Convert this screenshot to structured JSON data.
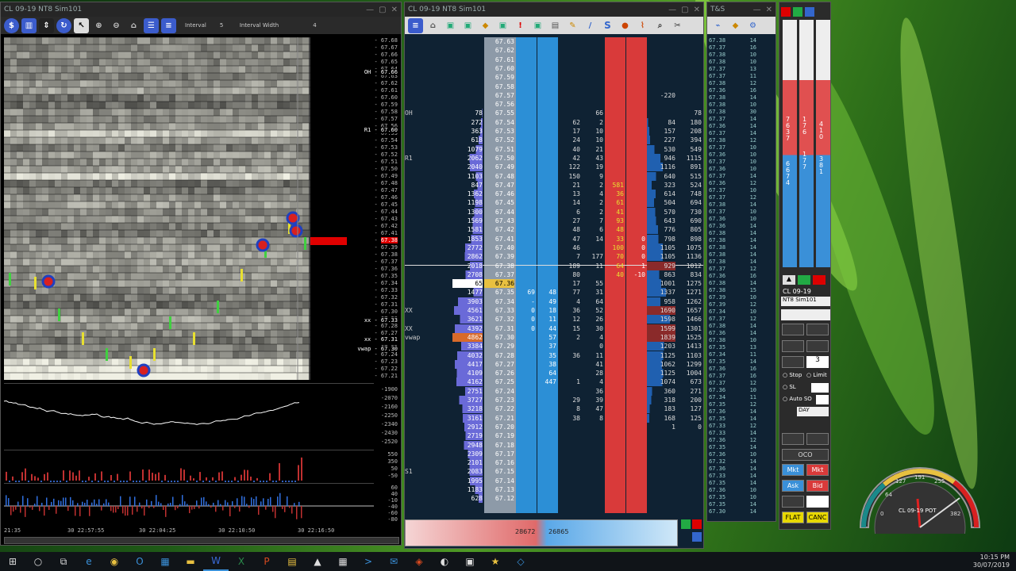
{
  "chart_window": {
    "title": "CL 09-19 NT8 Sim101",
    "toolbar": {
      "interval_label": "Interval",
      "interval_value": "5",
      "width_label": "Interval Width",
      "width_value": "4"
    },
    "price_labels": [
      "67.68",
      "67.67",
      "67.66",
      "67.65",
      "67.64",
      "67.63",
      "67.62",
      "67.61",
      "67.60",
      "67.59",
      "67.58",
      "67.57",
      "67.56",
      "67.55",
      "67.54",
      "67.53",
      "67.52",
      "67.51",
      "67.50",
      "67.49",
      "67.48",
      "67.47",
      "67.46",
      "67.45",
      "67.44",
      "67.43",
      "67.42",
      "67.41",
      "67.40",
      "67.39",
      "67.38",
      "67.37",
      "67.36",
      "67.35",
      "67.34",
      "67.33",
      "67.32",
      "67.31",
      "67.30",
      "67.29",
      "67.28",
      "67.27",
      "67.26",
      "67.25",
      "67.24",
      "67.23",
      "67.22",
      "67.21"
    ],
    "level_tags": {
      "oh": "OH - 67.66",
      "r1": "R1 - 67.60",
      "xx1": "xx - 67.33",
      "xx2": "xx - 67.31",
      "vwap": "vwap - 67.30"
    },
    "current_price": "67.38",
    "delta_scale": [
      "-1900",
      "-2070",
      "-2160",
      "-2250",
      "-2340",
      "-2430",
      "-2520"
    ],
    "vol_scale": [
      "550",
      "350",
      "50",
      "-50"
    ],
    "osc_scale": [
      "60",
      "40",
      "-10",
      "-40",
      "-60",
      "-80"
    ],
    "time_labels": [
      "21:35",
      "30 22:57:55",
      "30 22:04:25",
      "30 22:10:50",
      "30 22:16:50"
    ]
  },
  "dom_window": {
    "title": "CL 09-19 NT8 Sim101",
    "bid_total": "28672",
    "ask_total": "26865",
    "rows": [
      {
        "lbl": "",
        "vol": "",
        "price": "67.63",
        "bid": "",
        "ask": "",
        "c1": "",
        "c2": "",
        "s": "",
        "b": "",
        "d": "",
        "t": ""
      },
      {
        "lbl": "",
        "vol": "",
        "price": "67.62",
        "bid": "",
        "ask": "",
        "c1": "",
        "c2": "",
        "s": "",
        "b": "",
        "d": "",
        "t": ""
      },
      {
        "lbl": "",
        "vol": "",
        "price": "67.61",
        "bid": "",
        "ask": "",
        "c1": "",
        "c2": "",
        "s": "",
        "b": "",
        "d": "",
        "t": ""
      },
      {
        "lbl": "",
        "vol": "",
        "price": "67.60",
        "bid": "",
        "ask": "",
        "c1": "",
        "c2": "",
        "s": "",
        "b": "",
        "d": "",
        "t": ""
      },
      {
        "lbl": "",
        "vol": "",
        "price": "67.59",
        "bid": "",
        "ask": "",
        "c1": "",
        "c2": "",
        "s": "",
        "b": "",
        "d": "",
        "t": ""
      },
      {
        "lbl": "",
        "vol": "",
        "price": "67.58",
        "bid": "",
        "ask": "",
        "c1": "",
        "c2": "",
        "s": "",
        "b": "",
        "d": "",
        "t": ""
      },
      {
        "lbl": "",
        "vol": "",
        "price": "67.57",
        "bid": "",
        "ask": "",
        "c1": "",
        "c2": "",
        "s": "",
        "b": "",
        "d": "-220",
        "t": ""
      },
      {
        "lbl": "",
        "vol": "",
        "price": "67.56",
        "bid": "",
        "ask": "",
        "c1": "",
        "c2": "",
        "s": "",
        "b": "",
        "d": "",
        "t": ""
      },
      {
        "lbl": "OH",
        "vol": "78",
        "price": "67.55",
        "bid": "",
        "ask": "",
        "c1": "",
        "c2": "66",
        "s": "",
        "b": "",
        "d": "",
        "t": "78"
      },
      {
        "lbl": "",
        "vol": "272",
        "price": "67.54",
        "bid": "",
        "ask": "",
        "c1": "62",
        "c2": "2",
        "s": "",
        "b": "",
        "d": "84",
        "t": "180"
      },
      {
        "lbl": "",
        "vol": "363",
        "price": "67.53",
        "bid": "",
        "ask": "",
        "c1": "17",
        "c2": "10",
        "s": "",
        "b": "",
        "d": "157",
        "t": "208"
      },
      {
        "lbl": "",
        "vol": "618",
        "price": "67.52",
        "bid": "",
        "ask": "",
        "c1": "24",
        "c2": "10",
        "s": "",
        "b": "",
        "d": "227",
        "t": "394"
      },
      {
        "lbl": "",
        "vol": "1079",
        "price": "67.51",
        "bid": "",
        "ask": "",
        "c1": "40",
        "c2": "21",
        "s": "",
        "b": "",
        "d": "530",
        "t": "549"
      },
      {
        "lbl": "R1",
        "vol": "2062",
        "price": "67.50",
        "bid": "",
        "ask": "",
        "c1": "42",
        "c2": "43",
        "s": "",
        "b": "",
        "d": "946",
        "t": "1115"
      },
      {
        "lbl": "",
        "vol": "2040",
        "price": "67.49",
        "bid": "",
        "ask": "",
        "c1": "122",
        "c2": "19",
        "s": "",
        "b": "",
        "d": "1116",
        "t": "891"
      },
      {
        "lbl": "",
        "vol": "1103",
        "price": "67.48",
        "bid": "",
        "ask": "",
        "c1": "150",
        "c2": "9",
        "s": "",
        "b": "",
        "d": "640",
        "t": "515"
      },
      {
        "lbl": "",
        "vol": "847",
        "price": "67.47",
        "bid": "",
        "ask": "",
        "c1": "21",
        "c2": "2",
        "s": "581",
        "b": "",
        "d": "323",
        "t": "524"
      },
      {
        "lbl": "",
        "vol": "1362",
        "price": "67.46",
        "bid": "",
        "ask": "",
        "c1": "13",
        "c2": "4",
        "s": "36",
        "b": "",
        "d": "614",
        "t": "748"
      },
      {
        "lbl": "",
        "vol": "1198",
        "price": "67.45",
        "bid": "",
        "ask": "",
        "c1": "14",
        "c2": "2",
        "s": "61",
        "b": "",
        "d": "504",
        "t": "694"
      },
      {
        "lbl": "",
        "vol": "1300",
        "price": "67.44",
        "bid": "",
        "ask": "",
        "c1": "6",
        "c2": "2",
        "s": "41",
        "b": "",
        "d": "570",
        "t": "730"
      },
      {
        "lbl": "",
        "vol": "1569",
        "price": "67.43",
        "bid": "",
        "ask": "",
        "c1": "27",
        "c2": "7",
        "s": "93",
        "b": "",
        "d": "643",
        "t": "690"
      },
      {
        "lbl": "",
        "vol": "1581",
        "price": "67.42",
        "bid": "",
        "ask": "",
        "c1": "48",
        "c2": "6",
        "s": "48",
        "b": "",
        "d": "776",
        "t": "805"
      },
      {
        "lbl": "",
        "vol": "1853",
        "price": "67.41",
        "bid": "",
        "ask": "",
        "c1": "47",
        "c2": "14",
        "s": "33",
        "b": "0",
        "d": "798",
        "t": "898"
      },
      {
        "lbl": "",
        "vol": "2772",
        "price": "67.40",
        "bid": "",
        "ask": "",
        "c1": "46",
        "c2": "",
        "s": "100",
        "b": "0",
        "d": "1105",
        "t": "1075"
      },
      {
        "lbl": "",
        "vol": "2862",
        "price": "67.39",
        "bid": "",
        "ask": "",
        "c1": "7",
        "c2": "177",
        "s": "70",
        "b": "0",
        "d": "1105",
        "t": "1136"
      },
      {
        "lbl": "",
        "vol": "2018",
        "price": "67.38",
        "bid": "",
        "ask": "",
        "c1": "189",
        "c2": "11",
        "s": "64",
        "b": "1",
        "d": "929",
        "t": "1012"
      },
      {
        "lbl": "",
        "vol": "2708",
        "price": "67.37",
        "bid": "",
        "ask": "",
        "c1": "80",
        "c2": "",
        "s": "40",
        "b": "-10",
        "d": "863",
        "t": "834"
      },
      {
        "lbl": "",
        "vol": "65",
        "price": "67.36",
        "bid": "",
        "ask": "",
        "c1": "17",
        "c2": "55",
        "s": "",
        "b": "",
        "d": "1001",
        "t": "1275"
      },
      {
        "lbl": "",
        "vol": "1477",
        "price": "67.35",
        "bid": "69",
        "ask": "48",
        "c1": "77",
        "c2": "31",
        "s": "",
        "b": "",
        "d": "1337",
        "t": "1271"
      },
      {
        "lbl": "",
        "vol": "3903",
        "price": "67.34",
        "bid": "-",
        "ask": "49",
        "c1": "4",
        "c2": "64",
        "s": "",
        "b": "",
        "d": "958",
        "t": "1262"
      },
      {
        "lbl": "XX",
        "vol": "4561",
        "price": "67.33",
        "bid": "0",
        "ask": "18",
        "c1": "36",
        "c2": "52",
        "s": "",
        "b": "",
        "d": "1690",
        "t": "1657"
      },
      {
        "lbl": "",
        "vol": "3621",
        "price": "67.32",
        "bid": "0",
        "ask": "11",
        "c1": "12",
        "c2": "26",
        "s": "",
        "b": "",
        "d": "1598",
        "t": "1466"
      },
      {
        "lbl": "XX",
        "vol": "4392",
        "price": "67.31",
        "bid": "0",
        "ask": "44",
        "c1": "15",
        "c2": "30",
        "s": "",
        "b": "",
        "d": "1599",
        "t": "1301"
      },
      {
        "lbl": "vwap",
        "vol": "4862",
        "price": "67.30",
        "bid": "",
        "ask": "57",
        "c1": "2",
        "c2": "4",
        "s": "",
        "b": "",
        "d": "1839",
        "t": "1525"
      },
      {
        "lbl": "",
        "vol": "3384",
        "price": "67.29",
        "bid": "",
        "ask": "37",
        "c1": "",
        "c2": "0",
        "s": "",
        "b": "",
        "d": "1203",
        "t": "1413"
      },
      {
        "lbl": "",
        "vol": "4032",
        "price": "67.28",
        "bid": "",
        "ask": "35",
        "c1": "36",
        "c2": "11",
        "s": "",
        "b": "",
        "d": "1125",
        "t": "1103"
      },
      {
        "lbl": "",
        "vol": "4417",
        "price": "67.27",
        "bid": "",
        "ask": "38",
        "c1": "",
        "c2": "41",
        "s": "",
        "b": "",
        "d": "1062",
        "t": "1299"
      },
      {
        "lbl": "",
        "vol": "4109",
        "price": "67.26",
        "bid": "",
        "ask": "64",
        "c1": "",
        "c2": "28",
        "s": "",
        "b": "",
        "d": "1125",
        "t": "1004"
      },
      {
        "lbl": "",
        "vol": "4162",
        "price": "67.25",
        "bid": "",
        "ask": "447",
        "c1": "1",
        "c2": "4",
        "s": "",
        "b": "",
        "d": "1074",
        "t": "673"
      },
      {
        "lbl": "",
        "vol": "2751",
        "price": "67.24",
        "bid": "",
        "ask": "",
        "c1": "",
        "c2": "36",
        "s": "",
        "b": "",
        "d": "360",
        "t": "271"
      },
      {
        "lbl": "",
        "vol": "3727",
        "price": "67.23",
        "bid": "",
        "ask": "",
        "c1": "29",
        "c2": "39",
        "s": "",
        "b": "",
        "d": "318",
        "t": "200"
      },
      {
        "lbl": "",
        "vol": "3218",
        "price": "67.22",
        "bid": "",
        "ask": "",
        "c1": "8",
        "c2": "47",
        "s": "",
        "b": "",
        "d": "183",
        "t": "127"
      },
      {
        "lbl": "",
        "vol": "3161",
        "price": "67.21",
        "bid": "",
        "ask": "",
        "c1": "38",
        "c2": "8",
        "s": "",
        "b": "",
        "d": "168",
        "t": "125"
      },
      {
        "lbl": "",
        "vol": "2912",
        "price": "67.20",
        "bid": "",
        "ask": "",
        "c1": "",
        "c2": "",
        "s": "",
        "b": "",
        "d": "1",
        "t": "0"
      },
      {
        "lbl": "",
        "vol": "2719",
        "price": "67.19",
        "bid": "",
        "ask": "",
        "c1": "",
        "c2": "",
        "s": "",
        "b": "",
        "d": "",
        "t": ""
      },
      {
        "lbl": "",
        "vol": "2948",
        "price": "67.18",
        "bid": "",
        "ask": "",
        "c1": "",
        "c2": "",
        "s": "",
        "b": "",
        "d": "",
        "t": ""
      },
      {
        "lbl": "",
        "vol": "2309",
        "price": "67.17",
        "bid": "",
        "ask": "",
        "c1": "",
        "c2": "",
        "s": "",
        "b": "",
        "d": "",
        "t": ""
      },
      {
        "lbl": "",
        "vol": "2101",
        "price": "67.16",
        "bid": "",
        "ask": "",
        "c1": "",
        "c2": "",
        "s": "",
        "b": "",
        "d": "",
        "t": ""
      },
      {
        "lbl": "S1",
        "vol": "2083",
        "price": "67.15",
        "bid": "",
        "ask": "",
        "c1": "",
        "c2": "",
        "s": "",
        "b": "",
        "d": "",
        "t": ""
      },
      {
        "lbl": "",
        "vol": "1995",
        "price": "67.14",
        "bid": "",
        "ask": "",
        "c1": "",
        "c2": "",
        "s": "",
        "b": "",
        "d": "",
        "t": ""
      },
      {
        "lbl": "",
        "vol": "1183",
        "price": "67.13",
        "bid": "",
        "ask": "",
        "c1": "",
        "c2": "",
        "s": "",
        "b": "",
        "d": "",
        "t": ""
      },
      {
        "lbl": "",
        "vol": "628",
        "price": "67.12",
        "bid": "",
        "ask": "",
        "c1": "",
        "c2": "",
        "s": "",
        "b": "",
        "d": "",
        "t": ""
      }
    ]
  },
  "ts_window": {
    "title": "T&S",
    "rows": [
      [
        "67.38",
        "14"
      ],
      [
        "67.37",
        "16"
      ],
      [
        "67.38",
        "10"
      ],
      [
        "67.38",
        "10"
      ],
      [
        "67.37",
        "13"
      ],
      [
        "67.37",
        "11"
      ],
      [
        "67.38",
        "12"
      ],
      [
        "67.36",
        "16"
      ],
      [
        "67.38",
        "14"
      ],
      [
        "67.38",
        "10"
      ],
      [
        "67.38",
        "30"
      ],
      [
        "67.37",
        "14"
      ],
      [
        "67.36",
        "14"
      ],
      [
        "67.37",
        "14"
      ],
      [
        "67.38",
        "12"
      ],
      [
        "67.37",
        "10"
      ],
      [
        "67.36",
        "10"
      ],
      [
        "67.37",
        "10"
      ],
      [
        "67.36",
        "10"
      ],
      [
        "67.37",
        "14"
      ],
      [
        "67.36",
        "12"
      ],
      [
        "67.37",
        "10"
      ],
      [
        "67.37",
        "12"
      ],
      [
        "67.38",
        "14"
      ],
      [
        "67.37",
        "10"
      ],
      [
        "67.36",
        "10"
      ],
      [
        "67.36",
        "14"
      ],
      [
        "67.38",
        "14"
      ],
      [
        "67.38",
        "14"
      ],
      [
        "67.38",
        "14"
      ],
      [
        "67.38",
        "14"
      ],
      [
        "67.38",
        "14"
      ],
      [
        "67.37",
        "12"
      ],
      [
        "67.36",
        "16"
      ],
      [
        "67.38",
        "14"
      ],
      [
        "67.38",
        "15"
      ],
      [
        "67.39",
        "10"
      ],
      [
        "67.39",
        "12"
      ],
      [
        "67.34",
        "10"
      ],
      [
        "67.37",
        "12"
      ],
      [
        "67.38",
        "14"
      ],
      [
        "67.36",
        "14"
      ],
      [
        "67.38",
        "10"
      ],
      [
        "67.35",
        "13"
      ],
      [
        "67.34",
        "11"
      ],
      [
        "67.35",
        "14"
      ],
      [
        "67.36",
        "16"
      ],
      [
        "67.37",
        "16"
      ],
      [
        "67.37",
        "12"
      ],
      [
        "67.36",
        "10"
      ],
      [
        "67.34",
        "11"
      ],
      [
        "67.35",
        "12"
      ],
      [
        "67.36",
        "14"
      ],
      [
        "67.35",
        "14"
      ],
      [
        "67.33",
        "12"
      ],
      [
        "67.33",
        "14"
      ],
      [
        "67.36",
        "12"
      ],
      [
        "67.35",
        "14"
      ],
      [
        "67.36",
        "10"
      ],
      [
        "67.32",
        "14"
      ],
      [
        "67.36",
        "14"
      ],
      [
        "67.33",
        "14"
      ],
      [
        "67.35",
        "14"
      ],
      [
        "67.36",
        "10"
      ],
      [
        "67.35",
        "10"
      ],
      [
        "67.35",
        "14"
      ],
      [
        "67.30",
        "14"
      ]
    ]
  },
  "chart_trader": {
    "bar_values": [
      "7637",
      "6674",
      "17 6",
      "177",
      "410",
      "381"
    ],
    "instrument": "CL 09-19",
    "account": "NT8 Sim101",
    "qty": "3",
    "stop_label": "Stop",
    "limit_label": "Limit",
    "sl_label": "SL",
    "auto_so_label": "Auto SO",
    "tif": "DAY",
    "oco_label": "OCO",
    "buy_mkt": "Mkt",
    "sell_mkt": "Mkt",
    "ask_label": "Ask",
    "bid_label": "Bid",
    "flat_label": "FLAT",
    "canc_label": "CANC"
  },
  "gauge": {
    "label": "CL 09-19 POT",
    "ticks": [
      "64",
      "127",
      "191",
      "255",
      "",
      "0",
      "382"
    ]
  },
  "taskbar": {
    "time": "10:15 PM",
    "date": "30/07/2019"
  }
}
